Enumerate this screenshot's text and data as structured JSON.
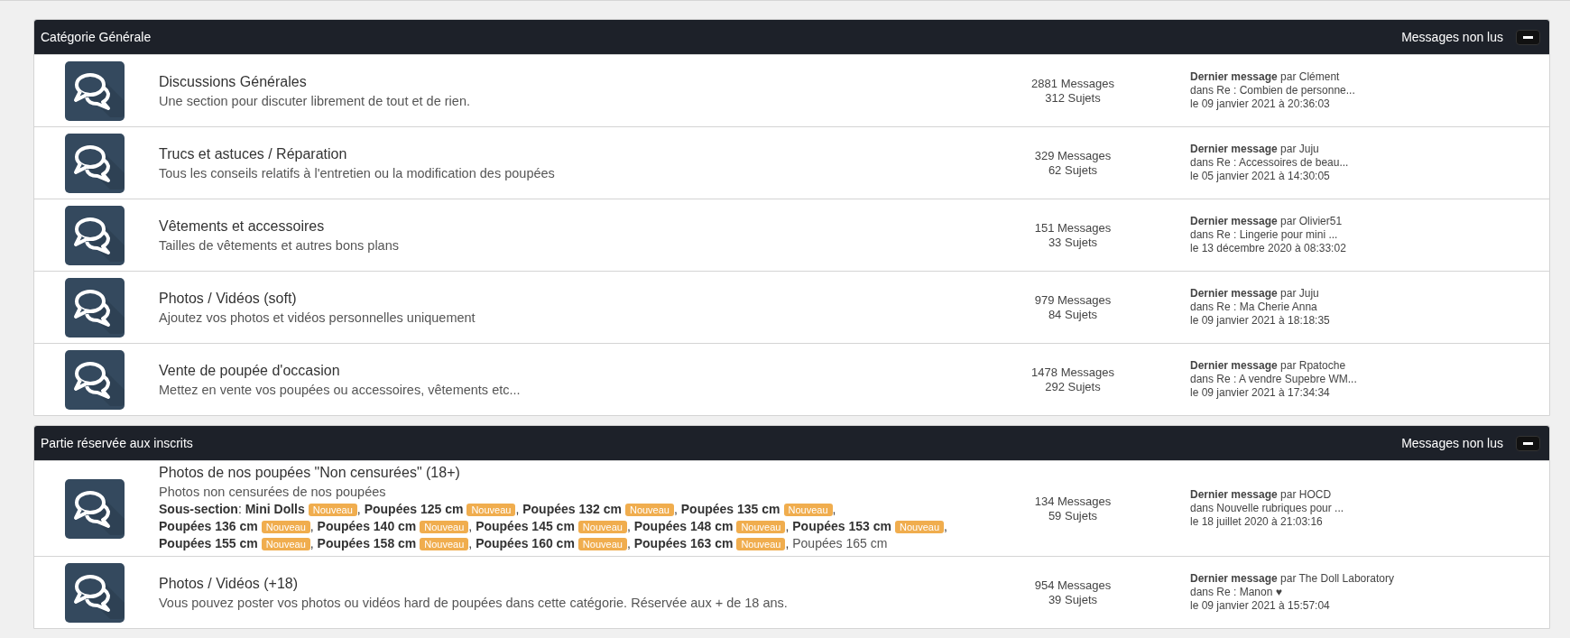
{
  "categories": [
    {
      "title": "Catégorie Générale",
      "unread_link": "Messages non lus",
      "forums": [
        {
          "title": "Discussions Générales",
          "description": "Une section pour discuter librement de tout et de rien.",
          "messages": "2881 Messages",
          "topics": "312 Sujets",
          "last_by": "**Dernier message** par Clément",
          "last_in": "dans Re : Combien de personne...",
          "last_date": "le 09 janvier 2021 à 20:36:03"
        },
        {
          "title": "Trucs et astuces / Réparation",
          "description": "Tous les conseils relatifs à l'entretien ou la modification des poupées",
          "messages": "329 Messages",
          "topics": "62 Sujets",
          "last_by": "**Dernier message** par Juju",
          "last_in": "dans Re : Accessoires de beau...",
          "last_date": "le 05 janvier 2021 à 14:30:05"
        },
        {
          "title": "Vêtements et accessoires",
          "description": "Tailles de vêtements et autres bons plans",
          "messages": "151 Messages",
          "topics": "33 Sujets",
          "last_by": "**Dernier message** par Olivier51",
          "last_in": "dans Re : Lingerie pour mini ...",
          "last_date": "le 13 décembre 2020 à 08:33:02"
        },
        {
          "title": "Photos / Vidéos (soft)",
          "description": "Ajoutez vos photos et vidéos personnelles uniquement",
          "messages": "979 Messages",
          "topics": "84 Sujets",
          "last_by": "**Dernier message** par Juju",
          "last_in": "dans Re : Ma Cherie Anna",
          "last_date": "le 09 janvier 2021 à 18:18:35"
        },
        {
          "title": "Vente de poupée d'occasion",
          "description": "Mettez en vente vos poupées ou accessoires, vêtements etc...",
          "messages": "1478 Messages",
          "topics": "292 Sujets",
          "last_by": "**Dernier message** par Rpatoche",
          "last_in": "dans Re : A vendre Supebre WM...",
          "last_date": "le 09 janvier 2021 à 17:34:34"
        }
      ]
    },
    {
      "title": "Partie réservée aux inscrits",
      "unread_link": "Messages non lus",
      "forums": [
        {
          "title": "Photos de nos poupées \"Non censurées\" (18+)",
          "description": "Photos non censurées de nos poupées",
          "subsection_label": "**Sous-section**:",
          "subforums": [
            {
              "name": "Mini Dolls",
              "unread": true,
              "badge": "Nouveau",
              "separator": ","
            },
            {
              "name": "Poupées 125 cm",
              "unread": true,
              "badge": "Nouveau",
              "separator": ","
            },
            {
              "name": "Poupées 132 cm",
              "unread": true,
              "badge": "Nouveau",
              "separator": ","
            },
            {
              "name": "Poupées 135 cm",
              "unread": true,
              "badge": "Nouveau",
              "separator": ","
            },
            {
              "name": "Poupées 136 cm",
              "unread": true,
              "badge": "Nouveau",
              "separator": ","
            },
            {
              "name": "Poupées 140 cm",
              "unread": true,
              "badge": "Nouveau",
              "separator": ","
            },
            {
              "name": "Poupées 145 cm",
              "unread": true,
              "badge": "Nouveau",
              "separator": ","
            },
            {
              "name": "Poupées 148 cm",
              "unread": true,
              "badge": "Nouveau",
              "separator": ","
            },
            {
              "name": "Poupées 153 cm",
              "unread": true,
              "badge": "Nouveau",
              "separator": ","
            },
            {
              "name": "Poupées 155 cm",
              "unread": true,
              "badge": "Nouveau",
              "separator": ","
            },
            {
              "name": "Poupées 158 cm",
              "unread": true,
              "badge": "Nouveau",
              "separator": ","
            },
            {
              "name": "Poupées 160 cm",
              "unread": true,
              "badge": "Nouveau",
              "separator": ","
            },
            {
              "name": "Poupées 163 cm",
              "unread": true,
              "badge": "Nouveau",
              "separator": ","
            },
            {
              "name": "Poupées 165 cm",
              "unread": false
            }
          ],
          "messages": "134 Messages",
          "topics": "59 Sujets",
          "last_by": "**Dernier message** par HOCD",
          "last_in": "dans Nouvelle rubriques pour ...",
          "last_date": "le 18 juillet 2020 à 21:03:16"
        },
        {
          "title": "Photos / Vidéos (+18)",
          "description": "Vous pouvez poster vos photos ou vidéos hard de poupées dans cette catégorie. Réservée aux + de 18 ans.",
          "messages": "954 Messages",
          "topics": "39 Sujets",
          "last_by": "**Dernier message** par The Doll Laboratory",
          "last_in": "dans Re : Manon ♥",
          "last_date": "le 09 janvier 2021 à 15:57:04"
        }
      ]
    }
  ]
}
